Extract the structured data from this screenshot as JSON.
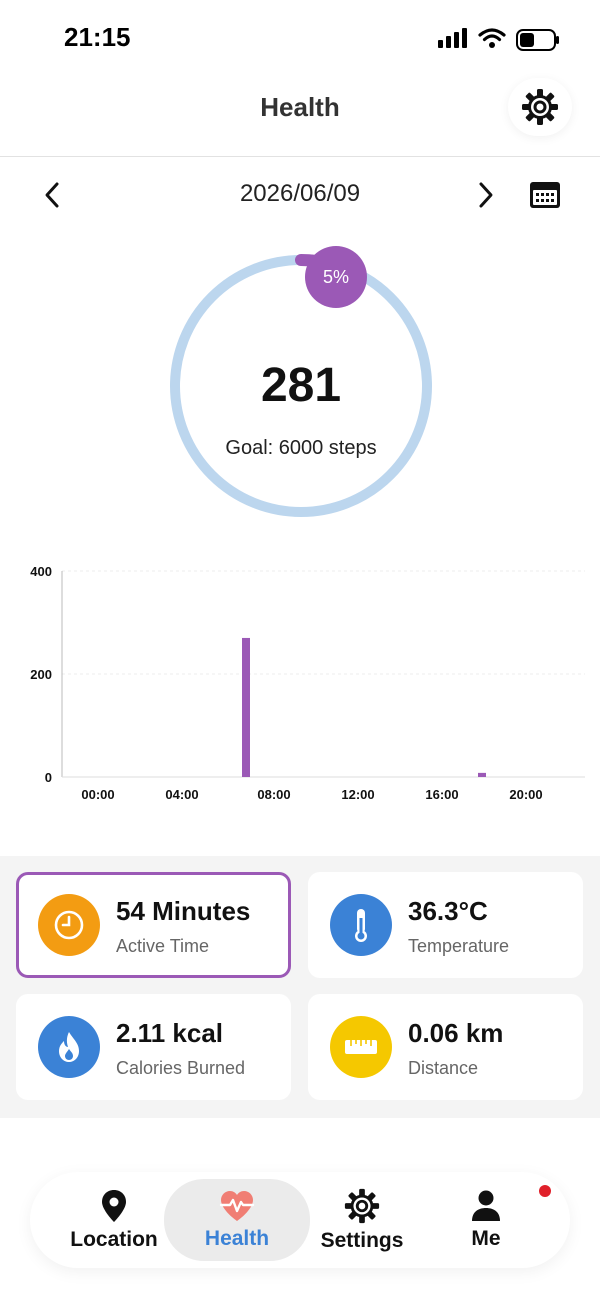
{
  "status_bar": {
    "time": "21:15"
  },
  "header": {
    "title": "Health"
  },
  "date_nav": {
    "date": "2026/06/09"
  },
  "progress": {
    "percent_label": "5%",
    "percent": 5,
    "steps": "281",
    "goal_label": "Goal: 6000 steps"
  },
  "chart_data": {
    "type": "bar",
    "x_tick_labels": [
      "00:00",
      "04:00",
      "08:00",
      "12:00",
      "16:00",
      "20:00"
    ],
    "y_tick_labels": [
      "400",
      "200",
      "0"
    ],
    "ylim": [
      0,
      400
    ],
    "x_range_hours": [
      0,
      24
    ],
    "points": [
      {
        "hour": 8,
        "value": 270
      },
      {
        "hour": 19.5,
        "value": 8
      }
    ],
    "bar_color": "#9b59b6",
    "grid": true
  },
  "stats": [
    {
      "value": "54 Minutes",
      "label": "Active Time",
      "icon": "clock-icon",
      "color": "#f39c12",
      "selected": true
    },
    {
      "value": "36.3°C",
      "label": "Temperature",
      "icon": "thermometer-icon",
      "color": "#3b82d6",
      "selected": false
    },
    {
      "value": "2.11 kcal",
      "label": "Calories Burned",
      "icon": "flame-icon",
      "color": "#3b82d6",
      "selected": false
    },
    {
      "value": "0.06 km",
      "label": "Distance",
      "icon": "ruler-icon",
      "color": "#f5c800",
      "selected": false
    }
  ],
  "bottom_nav": {
    "items": [
      {
        "label": "Location",
        "icon": "location-pin-icon"
      },
      {
        "label": "Health",
        "icon": "heart-pulse-icon",
        "active": true
      },
      {
        "label": "Settings",
        "icon": "gear-icon"
      },
      {
        "label": "Me",
        "icon": "person-icon"
      }
    ]
  },
  "colors": {
    "accent_purple": "#9b59b6",
    "ring_track": "#bcd6ee",
    "active_nav": "#3b82d6",
    "notification": "#e0202a"
  }
}
